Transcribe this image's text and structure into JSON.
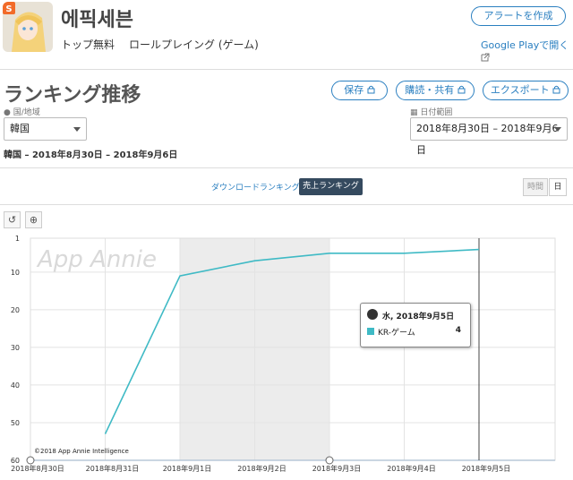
{
  "app": {
    "name": "에픽세븐",
    "category_rank": "トップ無料",
    "genre": "ロールプレイング (ゲーム)",
    "alert_button": "アラートを作成",
    "gplay_link": "Google Playで開く"
  },
  "page": {
    "title": "ランキング推移",
    "save_button": "保存",
    "share_button": "購読・共有",
    "export_button": "エクスポート",
    "country_label": "国/地域",
    "country_value": "韓国",
    "date_label": "日付範囲",
    "date_value": "2018年8月30日 – 2018年9月6日",
    "subtitle": "韓国 – 2018年8月30日 – 2018年9月6日",
    "tab_download": "ダウンロードランキング",
    "tab_revenue": "売上ランキング",
    "gran_hour": "時間",
    "gran_day": "日",
    "reset_icon": "↺",
    "zoom_icon": "⊕",
    "watermark": "App Annie",
    "copyright": "©2018 App Annie Intelligence"
  },
  "tooltip": {
    "date": "水, 2018年9月5日",
    "series": "KR-ゲーム",
    "value": "4",
    "color": "#3fbac5"
  },
  "chart_data": {
    "type": "line",
    "x": [
      "2018年8月30日",
      "2018年8月31日",
      "2018年9月1日",
      "2018年9月2日",
      "2018年9月3日",
      "2018年9月4日",
      "2018年9月5日"
    ],
    "y_ticks": [
      1,
      10,
      20,
      30,
      40,
      50,
      60
    ],
    "ylim": [
      60,
      1
    ],
    "series": [
      {
        "name": "KR-ゲーム",
        "values": [
          null,
          53,
          11,
          7,
          5,
          5,
          4
        ],
        "color": "#3fbac5"
      }
    ],
    "weekend_band": [
      "2018年9月1日",
      "2018年9月3日"
    ],
    "grid": true
  }
}
